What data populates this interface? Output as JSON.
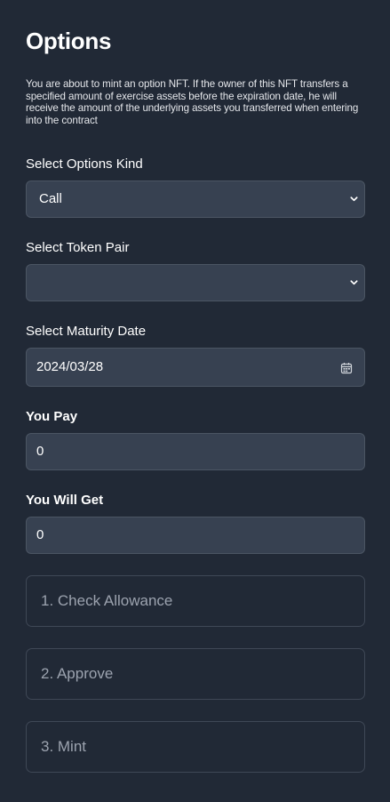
{
  "page": {
    "title": "Options",
    "description": "You are about to mint an option NFT. If the owner of this NFT transfers a specified amount of exercise assets before the expiration date, he will receive the amount of the underlying assets you transferred when entering into the contract"
  },
  "form": {
    "options_kind": {
      "label": "Select Options Kind",
      "value": "Call",
      "icon": "chevron-down-icon"
    },
    "token_pair": {
      "label": "Select Token Pair",
      "value": "",
      "icon": "chevron-down-icon"
    },
    "maturity_date": {
      "label": "Select Maturity Date",
      "value": "2024/03/28",
      "icon": "calendar-icon"
    },
    "you_pay": {
      "label": "You Pay",
      "value": "0"
    },
    "you_will_get": {
      "label": "You Will Get",
      "value": "0"
    }
  },
  "steps": [
    {
      "label": "1. Check Allowance"
    },
    {
      "label": "2. Approve"
    },
    {
      "label": "3. Mint"
    }
  ],
  "colors": {
    "background": "#212936",
    "field_background": "#374151",
    "field_border": "#4b5563",
    "step_border": "#3f4856",
    "step_text": "#9ca3af",
    "text": "#ffffff"
  }
}
